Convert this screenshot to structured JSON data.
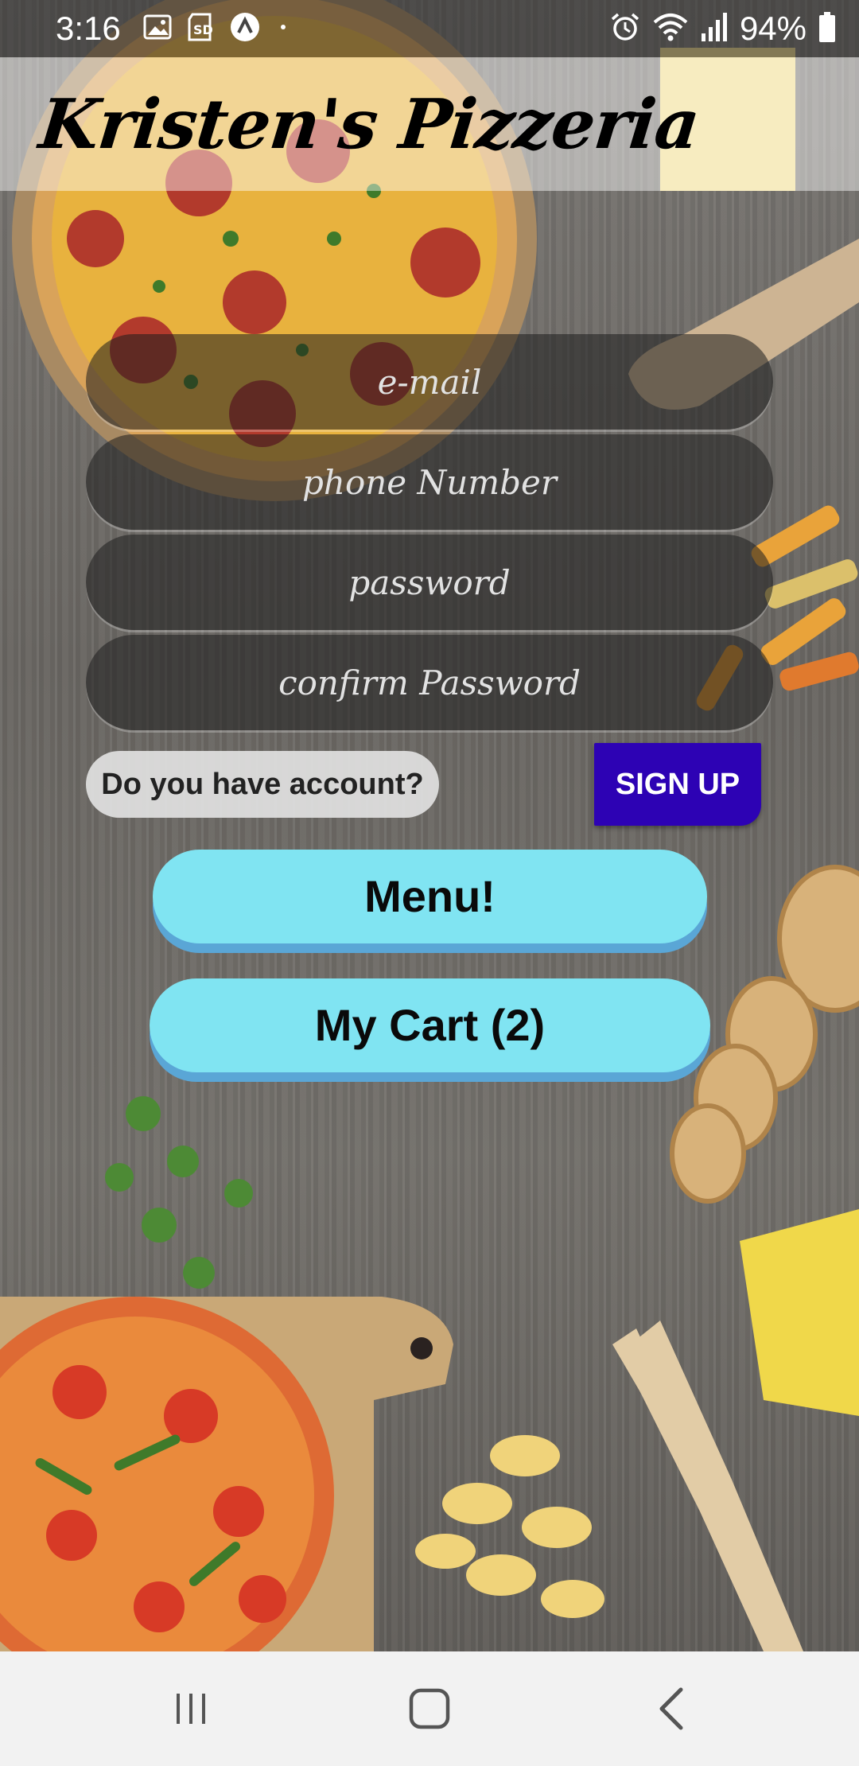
{
  "status_bar": {
    "time": "3:16",
    "battery": "94%",
    "left_icons": [
      "gallery-icon",
      "sd-card-icon",
      "app-notification-icon",
      "more-dot-icon"
    ],
    "right_icons": [
      "alarm-icon",
      "wifi-icon",
      "signal-icon",
      "battery-icon"
    ]
  },
  "app_bar": {
    "title": "Kristen's Pizzeria"
  },
  "form": {
    "email_placeholder": "e-mail",
    "phone_placeholder": "phone Number",
    "password_placeholder": "password",
    "confirm_password_placeholder": "confirm Password"
  },
  "account": {
    "question": "Do you have account?",
    "signup_label": "SIGN UP"
  },
  "buttons": {
    "menu_label": "Menu!",
    "cart_label": "My Cart (2)"
  },
  "nav_bar": {
    "icons": [
      "recent-apps-icon",
      "home-icon",
      "back-icon"
    ]
  },
  "colors": {
    "signup_bg": "#2d02b4",
    "pill_button_bg": "#80e4f2",
    "pill_button_shadow": "#5aa6d6",
    "field_bg": "rgba(30,30,30,0.55)"
  }
}
